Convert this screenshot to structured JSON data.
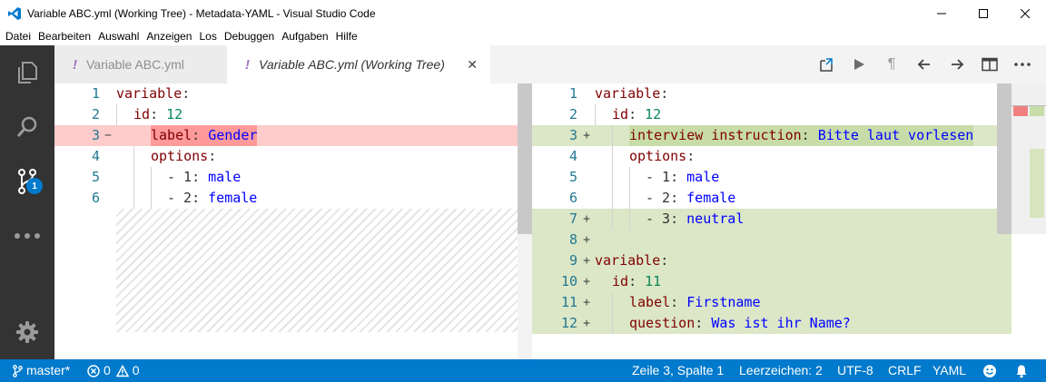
{
  "window": {
    "title": "Variable ABC.yml (Working Tree) - Metadata-YAML - Visual Studio Code",
    "accent": "#007acc"
  },
  "menu": [
    "Datei",
    "Bearbeiten",
    "Auswahl",
    "Anzeigen",
    "Los",
    "Debuggen",
    "Aufgaben",
    "Hilfe"
  ],
  "activity": {
    "scm_badge": "1"
  },
  "tabs": [
    {
      "label": "Variable ABC.yml",
      "icon": "!",
      "active": false
    },
    {
      "label": "Variable ABC.yml (Working Tree)",
      "icon": "!",
      "active": true,
      "close": "✕"
    }
  ],
  "diff": {
    "left": [
      {
        "num": "1",
        "marker": "",
        "key": "variable",
        "value": ""
      },
      {
        "num": "2",
        "marker": "",
        "key": "id",
        "value": "12"
      },
      {
        "num": "3",
        "marker": "−",
        "key": "label",
        "value": "Gender"
      },
      {
        "num": "4",
        "marker": "",
        "key": "options",
        "value": ""
      },
      {
        "num": "5",
        "marker": "",
        "key": "- 1",
        "value": "male"
      },
      {
        "num": "6",
        "marker": "",
        "key": "- 2",
        "value": "female"
      }
    ],
    "right": [
      {
        "num": "1",
        "marker": "",
        "key": "variable",
        "value": ""
      },
      {
        "num": "2",
        "marker": "",
        "key": "id",
        "value": "12"
      },
      {
        "num": "3",
        "marker": "+",
        "key": "interview instruction",
        "value": "Bitte laut vorlesen"
      },
      {
        "num": "4",
        "marker": "",
        "key": "options",
        "value": ""
      },
      {
        "num": "5",
        "marker": "",
        "key": "- 1",
        "value": "male"
      },
      {
        "num": "6",
        "marker": "",
        "key": "- 2",
        "value": "female"
      },
      {
        "num": "7",
        "marker": "+",
        "key": "- 3",
        "value": "neutral"
      },
      {
        "num": "8",
        "marker": "+",
        "key": "",
        "value": ""
      },
      {
        "num": "9",
        "marker": "+",
        "key": "variable",
        "value": ""
      },
      {
        "num": "10",
        "marker": "+",
        "key": "id",
        "value": "11"
      },
      {
        "num": "11",
        "marker": "+",
        "key": "label",
        "value": "Firstname"
      },
      {
        "num": "12",
        "marker": "+",
        "key": "question",
        "value": "Was ist ihr Name?"
      }
    ]
  },
  "status": {
    "branch": "master*",
    "errors": "0",
    "warnings": "0",
    "position": "Zeile 3, Spalte 1",
    "indent": "Leerzeichen: 2",
    "encoding": "UTF-8",
    "eol": "CRLF",
    "language": "YAML"
  }
}
